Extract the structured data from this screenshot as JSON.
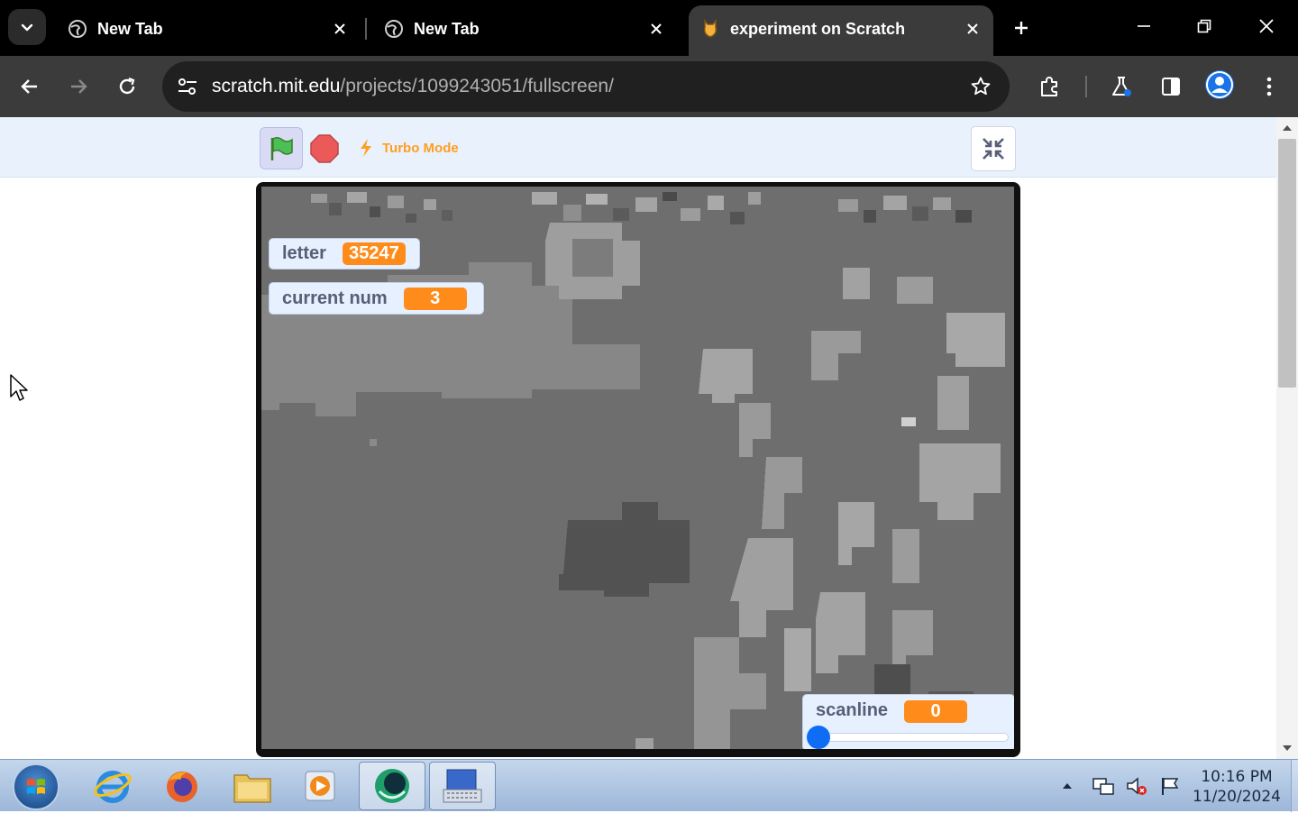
{
  "browser": {
    "tabs": [
      {
        "title": "New Tab",
        "active": false,
        "favicon": "globe-icon"
      },
      {
        "title": "New Tab",
        "active": false,
        "favicon": "globe-icon"
      },
      {
        "title": "experiment on Scratch",
        "active": true,
        "favicon": "scratch-cat-icon"
      }
    ],
    "url_host": "scratch.mit.edu",
    "url_path": "/projects/1099243051/fullscreen/"
  },
  "scratch": {
    "turbo_label": "Turbo Mode",
    "monitors": {
      "letter": {
        "label": "letter",
        "value": "35247"
      },
      "current_num": {
        "label": "current num",
        "value": "3"
      },
      "scanline": {
        "label": "scanline",
        "value": "0",
        "slider_fraction": 0
      }
    }
  },
  "taskbar": {
    "apps": [
      "start-orb",
      "internet-explorer-icon",
      "firefox-icon",
      "file-explorer-icon",
      "media-player-icon",
      "app-icon",
      "on-screen-keyboard-icon"
    ],
    "time": "10:16 PM",
    "date": "11/20/2024"
  },
  "colors": {
    "accent_orange": "#ff8c1a",
    "monitor_bg": "#e6f0ff",
    "scratch_header": "#e9f1fc",
    "stage_bg": "#6e6e6e"
  }
}
